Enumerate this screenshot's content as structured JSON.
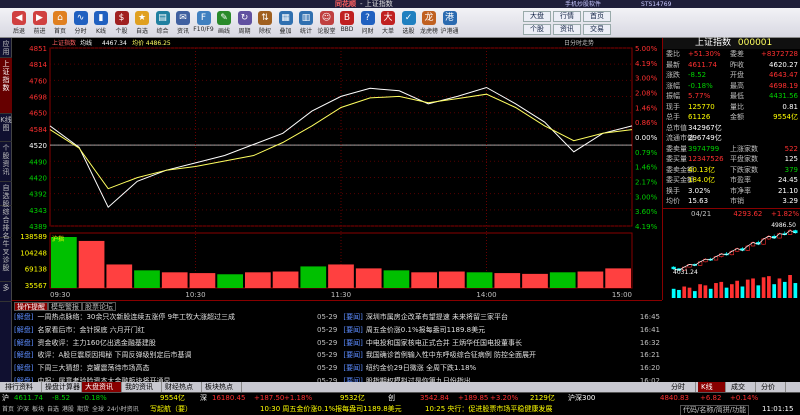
{
  "app": {
    "name": "同花顺",
    "window_title": "- 上证指数",
    "right_text_1": "手机炒股软件",
    "right_text_2": "STS14769"
  },
  "toolbar": {
    "buttons": [
      {
        "label": "后退",
        "icon": "back-icon",
        "color": "#d04040"
      },
      {
        "label": "前进",
        "icon": "forward-icon",
        "color": "#d04040"
      },
      {
        "label": "首页",
        "icon": "home-icon",
        "color": "#e08020"
      },
      {
        "label": "分时",
        "icon": "timeshare-icon",
        "color": "#2060c0"
      },
      {
        "label": "K线",
        "icon": "kline-icon",
        "color": "#2060c0"
      },
      {
        "label": "个股",
        "icon": "stock-icon",
        "color": "#a02020"
      },
      {
        "label": "自选",
        "icon": "star-icon",
        "color": "#e0a020"
      },
      {
        "label": "综合",
        "icon": "table-icon",
        "color": "#2080a0"
      },
      {
        "label": "资讯",
        "icon": "news-icon",
        "color": "#4060a0"
      },
      {
        "label": "F10/F9",
        "icon": "f10-icon",
        "color": "#4080c0"
      },
      {
        "label": "画线",
        "icon": "pen-icon",
        "color": "#2a8a2a"
      },
      {
        "label": "周期",
        "icon": "cycle-icon",
        "color": "#6050a0"
      },
      {
        "label": "除权",
        "icon": "exright-icon",
        "color": "#a06020"
      },
      {
        "label": "叠加",
        "icon": "overlay-icon",
        "color": "#3070b0"
      },
      {
        "label": "统计",
        "icon": "stats-icon",
        "color": "#3070b0"
      },
      {
        "label": "论股堂",
        "icon": "forum-icon",
        "color": "#c04040"
      },
      {
        "label": "BBD",
        "icon": "bbd-icon",
        "color": "#c02020"
      },
      {
        "label": "问财",
        "icon": "search-icon",
        "color": "#2060c0"
      },
      {
        "label": "大单",
        "icon": "bigorder-icon",
        "color": "#c02020"
      },
      {
        "label": "选股",
        "icon": "screener-icon",
        "color": "#2080c0"
      },
      {
        "label": "龙虎榜",
        "icon": "dragon-icon",
        "color": "#c06020"
      },
      {
        "label": "沪港通",
        "icon": "hk-connect-icon",
        "color": "#2a6ab0"
      }
    ],
    "right_buttons": [
      "大盘",
      "行情",
      "首页",
      "个股",
      "资讯",
      "交易"
    ]
  },
  "sidebar": {
    "tabs": [
      "应用",
      "上证指数",
      "K线图",
      "个股资讯",
      "自选股",
      "综合排名",
      "牛叉诊股",
      "多"
    ]
  },
  "chart": {
    "legend": {
      "name": "上证指数",
      "line1": "均线",
      "price": "4467.34",
      "avg": "均价 4486.25",
      "right_label": "日分时走势"
    },
    "y_labels": [
      "4851",
      "4814",
      "4760",
      "4698",
      "4650",
      "4584",
      "4520",
      "4490",
      "4420",
      "4392",
      "4343",
      "4389"
    ],
    "pct_labels": [
      "5.00%",
      "4.19%",
      "3.00%",
      "2.08%",
      "1.46%",
      "0.86%",
      "0.00%",
      "0.79%",
      "1.46%",
      "2.17%",
      "3.00%",
      "3.60%",
      "4.19%"
    ],
    "prev_close": "4520",
    "vol_labels": [
      "138589",
      "104248",
      "69138",
      "35567"
    ],
    "time_labels": [
      "09:30",
      "10:30",
      "11:30",
      "14:00",
      "15:00"
    ],
    "subtabs": [
      "沪指"
    ]
  },
  "chart_data": {
    "type": "line",
    "title": "上证指数",
    "x": [
      "09:30",
      "10:30",
      "11:30",
      "14:00",
      "15:00"
    ],
    "ylim": [
      4369,
      4851
    ],
    "prev_close": 4520,
    "series": [
      {
        "name": "上证指数",
        "values": [
          4640,
          4582,
          4420,
          4490,
          4520,
          4540,
          4560,
          4590,
          4620,
          4680,
          4720,
          4742,
          4735,
          4700,
          4720,
          4744,
          4700,
          4650,
          4570,
          4620,
          4640
        ]
      },
      {
        "name": "均线",
        "values": [
          4630,
          4580,
          4470,
          4500,
          4520,
          4530,
          4545,
          4560,
          4595,
          4640,
          4690,
          4716,
          4720,
          4703,
          4714,
          4726,
          4690,
          4640,
          4600,
          4620,
          4630
        ]
      }
    ],
    "volume": [
      130,
      120,
      60,
      45,
      40,
      38,
      35,
      40,
      42,
      55,
      60,
      50,
      45,
      40,
      42,
      40,
      38,
      36,
      40,
      42,
      50
    ]
  },
  "quote": {
    "title": "上证指数",
    "code": "000001",
    "rows": [
      {
        "label": "委比",
        "value": "+51.30%",
        "label2": "委差",
        "value2": "+8372728",
        "c1": "#ff3030",
        "c2": "#ff3030"
      },
      {
        "label": "最新",
        "value": "4611.74",
        "label2": "昨收",
        "value2": "4620.27",
        "c1": "#ff3030",
        "c2": "#ffffff"
      },
      {
        "label": "涨跌",
        "value": "-8.52",
        "label2": "开盘",
        "value2": "4643.47",
        "c1": "#00d000",
        "c2": "#ff3030"
      },
      {
        "label": "涨幅",
        "value": "-0.18%",
        "label2": "最高",
        "value2": "4698.19",
        "c1": "#00d000",
        "c2": "#ff3030"
      },
      {
        "label": "振幅",
        "value": "5.77%",
        "label2": "最低",
        "value2": "4431.56",
        "c1": "#ff3030",
        "c2": "#00d000"
      },
      {
        "label": "现手",
        "value": "125770",
        "label2": "量比",
        "value2": "0.81",
        "c1": "#ffff00",
        "c2": "#ffffff"
      },
      {
        "label": "总手",
        "value": "61126",
        "label2": "金额",
        "value2": "9554亿",
        "c1": "#ffff00",
        "c2": "#ffff00"
      },
      {
        "label": "总市值",
        "value": "342967亿",
        "label2": "",
        "value2": "",
        "c1": "#ffffff",
        "c2": "#ffffff"
      },
      {
        "label": "流通市值",
        "value": "296749亿",
        "label2": "",
        "value2": "",
        "c1": "#ffffff",
        "c2": "#ffffff"
      },
      {
        "label": "委卖量",
        "value": "3974799",
        "label2": "上涨家数",
        "value2": "522",
        "c1": "#00d000",
        "c2": "#ff3030"
      },
      {
        "label": "委买量",
        "value": "12347526",
        "label2": "平盘家数",
        "value2": "125",
        "c1": "#ff3030",
        "c2": "#ffffff"
      },
      {
        "label": "委卖金额",
        "value": "40.13亿",
        "label2": "下跌家数",
        "value2": "379",
        "c1": "#ffff00",
        "c2": "#00d000"
      },
      {
        "label": "委买金额",
        "value": "184.0亿",
        "label2": "市盈率",
        "value2": "24.45",
        "c1": "#ffff00",
        "c2": "#ffffff"
      },
      {
        "label": "换手",
        "value": "3.02%",
        "label2": "市净率",
        "value2": "21.10",
        "c1": "#ffffff",
        "c2": "#ffffff"
      },
      {
        "label": "均价",
        "value": "15.63",
        "label2": "市销",
        "value2": "3.29",
        "c1": "#ffffff",
        "c2": "#ffffff"
      }
    ],
    "mini": {
      "date": "04/21",
      "price": "4293.62",
      "pct": "+1.82%",
      "high": "4986.50",
      "low": "4031.24"
    },
    "mini_tabs": [
      "分时",
      "K线",
      "成交",
      "分价"
    ]
  },
  "mini_kline": {
    "type": "bar",
    "candles": [
      [
        4120,
        4080,
        4140,
        4060
      ],
      [
        4080,
        4050,
        4100,
        4031
      ],
      [
        4050,
        4120,
        4130,
        4040
      ],
      [
        4120,
        4180,
        4190,
        4110
      ],
      [
        4180,
        4160,
        4200,
        4140
      ],
      [
        4160,
        4240,
        4250,
        4150
      ],
      [
        4240,
        4300,
        4320,
        4230
      ],
      [
        4300,
        4280,
        4330,
        4260
      ],
      [
        4280,
        4360,
        4370,
        4270
      ],
      [
        4360,
        4420,
        4440,
        4340
      ],
      [
        4420,
        4400,
        4460,
        4380
      ],
      [
        4400,
        4480,
        4500,
        4390
      ],
      [
        4480,
        4540,
        4560,
        4470
      ],
      [
        4540,
        4500,
        4570,
        4480
      ],
      [
        4500,
        4600,
        4620,
        4490
      ],
      [
        4600,
        4680,
        4700,
        4590
      ],
      [
        4680,
        4640,
        4720,
        4620
      ],
      [
        4640,
        4760,
        4780,
        4630
      ],
      [
        4760,
        4820,
        4850,
        4740
      ],
      [
        4820,
        4780,
        4860,
        4760
      ],
      [
        4780,
        4880,
        4900,
        4770
      ],
      [
        4880,
        4860,
        4930,
        4840
      ],
      [
        4860,
        4950,
        4986,
        4850
      ],
      [
        4950,
        4900,
        4970,
        4880
      ]
    ],
    "volume": [
      40,
      35,
      50,
      45,
      30,
      60,
      55,
      40,
      65,
      70,
      45,
      60,
      75,
      50,
      80,
      85,
      55,
      90,
      95,
      60,
      85,
      70,
      100,
      65
    ]
  },
  "news": {
    "tabs": [
      "操作提醒",
      "模型警报",
      "股票论坛"
    ],
    "left": [
      {
        "tag": "[解盘]",
        "text": "一周热点脉络：30余只次新股连续五涨停 9年工牧大涨超过三成"
      },
      {
        "tag": "[解盘]",
        "text": "名家看后市：金针探底 六月开门红"
      },
      {
        "tag": "[解盘]",
        "text": "资金收评：主力160亿出逃金融基建股"
      },
      {
        "tag": "[解盘]",
        "text": "收评：A股巨震原因揭秘 下周反弹级别定后市基调"
      },
      {
        "tag": "[解盘]",
        "text": "下周三大猜想：克罐震荡待市场高态"
      },
      {
        "tag": "[解盘]",
        "text": "中报：属意考验险资本大金融板块将开通显"
      }
    ],
    "right": [
      {
        "date": "05-29",
        "tag": "[要闻]",
        "text": "深圳市属房企改革有望提速 未来将留三家平台",
        "time": "16:45"
      },
      {
        "date": "05-29",
        "tag": "[要闻]",
        "text": "周五金价涨0.1%报每盎司1189.8美元",
        "time": "16:41"
      },
      {
        "date": "05-29",
        "tag": "[要闻]",
        "text": "中电投和国家核电正式合并 王炳华任国电投董事长",
        "time": "16:32"
      },
      {
        "date": "05-29",
        "tag": "[要闻]",
        "text": "我国确诊首例输入性中东呼吸综合征病例 防控全面展开",
        "time": "16:21"
      },
      {
        "date": "05-29",
        "tag": "[要闻]",
        "text": "纽约金价29日微涨 全周下跌1.18%",
        "time": "16:20"
      },
      {
        "date": "05-29",
        "tag": "[要闻]",
        "text": "股指期权模拟过是你第九日份指出",
        "time": "16:02"
      }
    ]
  },
  "bottom_tabs": [
    "排行资料",
    "操盘计算器",
    "大盘资讯",
    "我的资讯",
    "财经热点",
    "板块热点"
  ],
  "status": {
    "sh": {
      "label": "沪",
      "price": "4611.74",
      "chg": "-8.52",
      "pct": "-0.18%",
      "amt": "9554亿"
    },
    "sz": {
      "label": "深",
      "price": "16180.45",
      "chg": "+187.50",
      "pct": "+1.18%",
      "amt": "9532亿"
    },
    "cy": {
      "label": "创",
      "price": "3542.84",
      "chg": "+189.85",
      "pct": "+3.20%",
      "amt": "2129亿"
    },
    "hs": {
      "label": "沪深300",
      "price": "4840.83",
      "chg": "+6.82",
      "pct": "+0.14%"
    },
    "tabs": [
      "首页",
      "沪深",
      "板块",
      "自选",
      "港股",
      "期货",
      "全球",
      "24小时资讯"
    ],
    "ticker1": "写起航（要）",
    "ticker2": "10:30 周五金价涨0.1%报每盎司1189.8美元",
    "ticker3": "10:25 央行：促进股票市场平稳健康发展",
    "right": "代码/名称/简拼/功能",
    "clock": "11:01:15"
  }
}
